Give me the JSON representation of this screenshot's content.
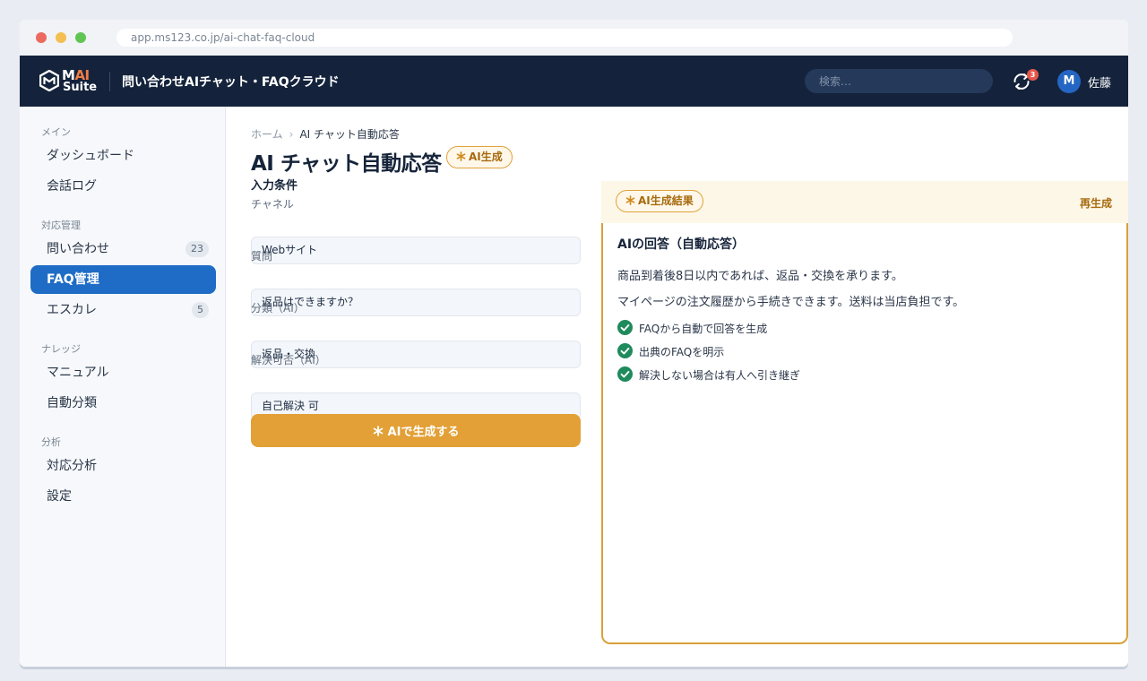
{
  "browser": {
    "url": "app.ms123.co.jp/ai-chat-faq-cloud"
  },
  "header": {
    "logo_top_m": "M",
    "logo_top_ai": "AI",
    "logo_bottom": "Suite",
    "app_title": "問い合わせAIチャット・FAQクラウド",
    "search_placeholder": "検索…",
    "notification_count": "3",
    "avatar_initial": "M",
    "user_name": "佐藤"
  },
  "sidebar": {
    "sections": [
      {
        "label": "メイン"
      },
      {
        "label": "対応管理"
      },
      {
        "label": "ナレッジ"
      },
      {
        "label": "分析"
      }
    ],
    "items": [
      {
        "label": "ダッシュボード"
      },
      {
        "label": "会話ログ"
      },
      {
        "label": "問い合わせ",
        "badge": "23"
      },
      {
        "label": "FAQ管理"
      },
      {
        "label": "エスカレ",
        "badge": "5"
      },
      {
        "label": "マニュアル"
      },
      {
        "label": "自動分類"
      },
      {
        "label": "対応分析"
      },
      {
        "label": "設定"
      }
    ],
    "active_item": "FAQ管理"
  },
  "breadcrumb": {
    "home": "ホーム",
    "separator": "›",
    "current": "AI チャット自動応答"
  },
  "page": {
    "title": "AI チャット自動応答",
    "ai_badge": "AI生成"
  },
  "form": {
    "section_title": "入力条件",
    "fields": [
      {
        "label": "チャネル",
        "value": "Webサイト"
      },
      {
        "label": "質問",
        "value": "返品はできますか？"
      },
      {
        "label": "分類（AI）",
        "value": "返品・交換"
      },
      {
        "label": "解決可否（AI）",
        "value": "自己解決 可"
      }
    ],
    "generate_button": "AIで生成する"
  },
  "result": {
    "badge": "AI生成結果",
    "regenerate": "再生成",
    "title": "AIの回答（自動応答）",
    "lines": [
      "商品到着後8日以内であれば、返品・交換を承ります。",
      "マイページの注文履歴から手続きできます。送料は当店負担です。"
    ],
    "checks": [
      "FAQから自動で回答を生成",
      "出典のFAQを明示",
      "解決しない場合は有人へ引き継ぎ"
    ]
  },
  "colors": {
    "topbar": "#14233b",
    "accent_blue": "#1f6cc6",
    "accent_gold": "#e2a036",
    "check_green": "#1f8a5b",
    "logo_orange": "#ef7d45"
  }
}
